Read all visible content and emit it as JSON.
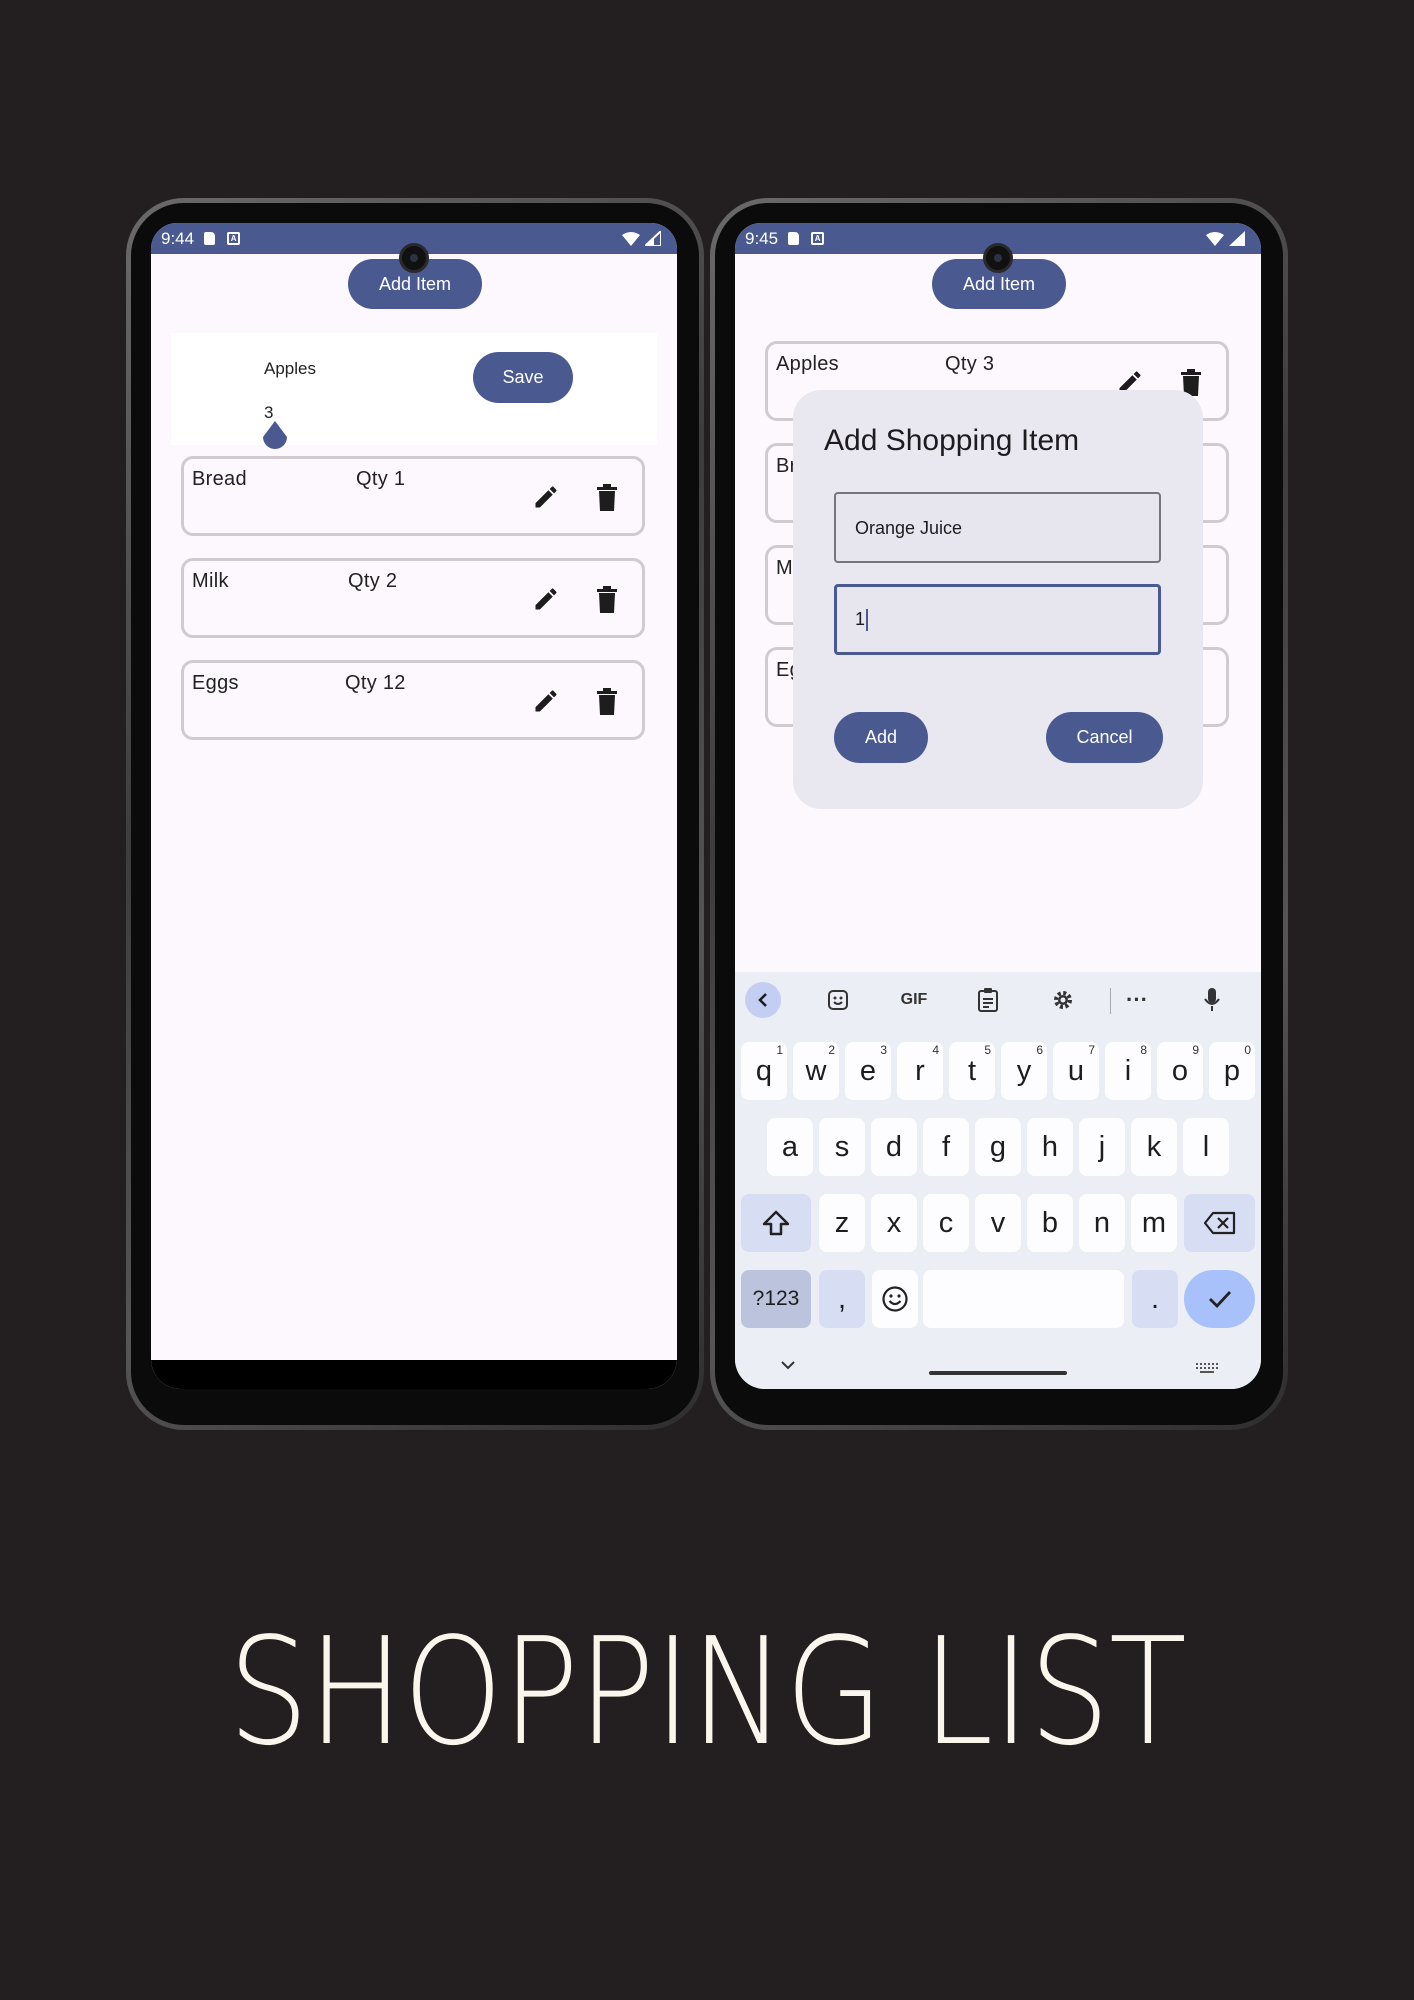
{
  "left_screen": {
    "status_time": "9:44",
    "add_button": "Add Item",
    "edit_panel": {
      "name_value": "Apples",
      "qty_value": "3",
      "save_button": "Save"
    },
    "items": [
      {
        "name": "Bread",
        "qty": "Qty 1"
      },
      {
        "name": "Milk",
        "qty": "Qty 2"
      },
      {
        "name": "Eggs",
        "qty": "Qty 12"
      }
    ]
  },
  "right_screen": {
    "status_time": "9:45",
    "add_button": "Add Item",
    "background_items": [
      {
        "name": "Apples",
        "qty": "Qty 3"
      },
      {
        "name": "Br"
      },
      {
        "name": "M"
      },
      {
        "name": "Eg"
      }
    ],
    "dialog": {
      "title": "Add Shopping Item",
      "name_field_value": "Orange Juice",
      "qty_field_value": "1",
      "add_button": "Add",
      "cancel_button": "Cancel"
    },
    "keyboard": {
      "toolbar": [
        "back-chevron-icon",
        "sticker-icon",
        "GIF",
        "clipboard-icon",
        "settings-gear-icon",
        "more-dots-icon",
        "microphone-icon"
      ],
      "row1": [
        {
          "k": "q",
          "n": "1"
        },
        {
          "k": "w",
          "n": "2"
        },
        {
          "k": "e",
          "n": "3"
        },
        {
          "k": "r",
          "n": "4"
        },
        {
          "k": "t",
          "n": "5"
        },
        {
          "k": "y",
          "n": "6"
        },
        {
          "k": "u",
          "n": "7"
        },
        {
          "k": "i",
          "n": "8"
        },
        {
          "k": "o",
          "n": "9"
        },
        {
          "k": "p",
          "n": "0"
        }
      ],
      "row2": [
        "a",
        "s",
        "d",
        "f",
        "g",
        "h",
        "j",
        "k",
        "l"
      ],
      "row3": [
        "z",
        "x",
        "c",
        "v",
        "b",
        "n",
        "m"
      ],
      "sym_key": "?123",
      "comma_key": ",",
      "period_key": "."
    }
  },
  "title": "SHOPPING LIST",
  "colors": {
    "primary": "#4a5a91",
    "background": "#231f20",
    "screen": "#fdf8fd",
    "dialog": "#e9e8f0",
    "title_text": "#faf6ec"
  }
}
